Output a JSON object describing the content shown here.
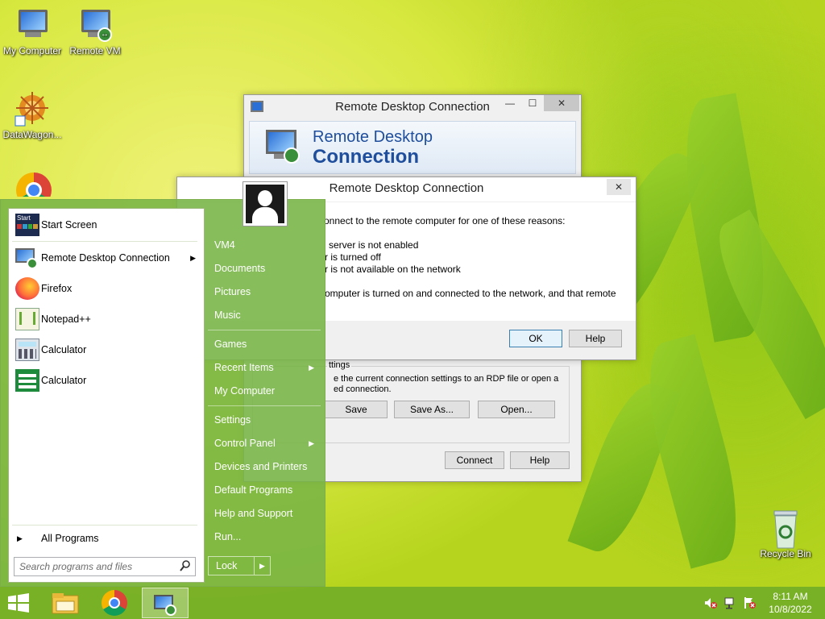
{
  "desktop": {
    "icons": [
      {
        "label": "My Computer"
      },
      {
        "label": "Remote VM"
      },
      {
        "label": "DataWagon..."
      },
      {
        "label": "Recycle Bin"
      }
    ]
  },
  "rdp_main": {
    "title": "Remote Desktop Connection",
    "banner_line1": "Remote Desktop",
    "banner_line2": "Connection",
    "settings_group": "ttings",
    "settings_text_line1": "e the current connection settings to an RDP file or open a",
    "settings_text_line2": "ed connection.",
    "save": "Save",
    "save_as": "Save As...",
    "open": "Open...",
    "connect": "Connect",
    "help": "Help"
  },
  "rdp_error": {
    "title": "Remote Desktop Connection",
    "line1": "onnect to the remote computer for one of these reasons:",
    "line2": "server is not enabled",
    "line3": "r is turned off",
    "line4": "r is not available on the network",
    "line5": "omputer is turned on and connected to the network, and that remote",
    "ok": "OK",
    "help": "Help"
  },
  "start_menu": {
    "programs": [
      {
        "label": "Start Screen"
      },
      {
        "label": "Remote Desktop Connection"
      },
      {
        "label": "Firefox"
      },
      {
        "label": "Notepad++"
      },
      {
        "label": "Calculator"
      },
      {
        "label": "Calculator"
      }
    ],
    "start_tile_text": "Start",
    "all_programs": "All Programs",
    "search_placeholder": "Search programs and files",
    "right_items": [
      {
        "label": "VM4"
      },
      {
        "label": "Documents"
      },
      {
        "label": "Pictures"
      },
      {
        "label": "Music"
      },
      {
        "label": "Games"
      },
      {
        "label": "Recent Items"
      },
      {
        "label": "My Computer"
      },
      {
        "label": "Settings"
      },
      {
        "label": "Control Panel"
      },
      {
        "label": "Devices and Printers"
      },
      {
        "label": "Default Programs"
      },
      {
        "label": "Help and Support"
      },
      {
        "label": "Run..."
      }
    ],
    "lock": "Lock"
  },
  "taskbar": {
    "time": "8:11 AM",
    "date": "10/8/2022"
  },
  "colors": {
    "accent_green": "#78b446",
    "rdp_title_blue": "#1f4e9c"
  }
}
